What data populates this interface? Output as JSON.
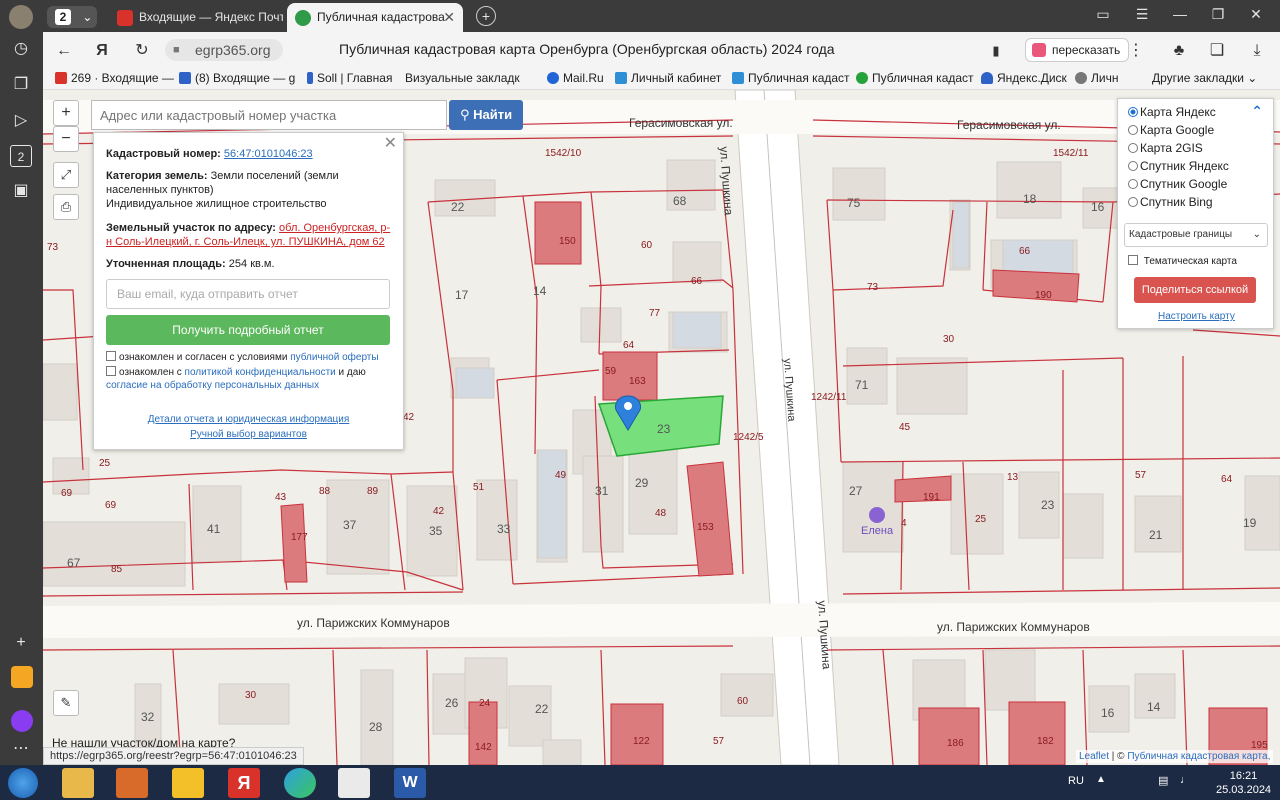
{
  "browser": {
    "tab_count": "2",
    "tabs": [
      {
        "label": "Входящие — Яндекс Почт"
      },
      {
        "label": "Публичная кадастрова"
      }
    ],
    "url": "egrp365.org",
    "page_title": "Публичная кадастровая карта Оренбурга (Оренбургская область) 2024 года",
    "translate_label": "пересказать",
    "status_url": "https://egrp365.org/reestr?egrp=56:47:0101046:23"
  },
  "bookmarks": [
    {
      "label": "269 · Входящие —",
      "color": "#d8322b"
    },
    {
      "label": "(8) Входящие — g",
      "color": "#2f62c7"
    },
    {
      "label": "Soll | Главная",
      "color": "#2f62c7"
    },
    {
      "label": "Визуальные закладк",
      "color": ""
    },
    {
      "label": "Mail.Ru",
      "color": "#1f65d6"
    },
    {
      "label": "Личный кабинет",
      "color": "#2f8fd6"
    },
    {
      "label": "Публичная кадаст",
      "color": "#2f8fd6"
    },
    {
      "label": "Публичная кадаст",
      "color": "#26a23a"
    },
    {
      "label": "Яндекс.Диск",
      "color": "#2f62c7"
    },
    {
      "label": "Личн",
      "color": "#777"
    },
    {
      "label": "Другие закладки",
      "color": ""
    }
  ],
  "search": {
    "placeholder": "Адрес или кадастровый номер участка",
    "button": "Найти"
  },
  "popup": {
    "cad_label": "Кадастровый номер:",
    "cad_value": "56:47:0101046:23",
    "category_label": "Категория земель:",
    "category_value": "Земли поселений (земли населенных пунктов)",
    "usage": "Индивидуальное жилищное строительство",
    "address_label": "Земельный участок по адресу:",
    "address_value": "обл. Оренбургская, р-н Соль-Илецкий, г. Соль-Илецк, ул. ПУШКИНА, дом 62",
    "area_label": "Уточненная площадь:",
    "area_value": "254 кв.м.",
    "email_placeholder": "Ваш email, куда отправить отчет",
    "report_button": "Получить подробный отчет",
    "consent1_a": "ознакомлен и согласен с условиями",
    "consent1_link": "публичной оферты",
    "consent2_a": "ознакомлен с",
    "consent2_link": "политикой конфиденциальности",
    "consent2_b": "и даю",
    "consent2_link2": "согласие на обработку персональных данных",
    "details_link": "Детали отчета и юридическая информация",
    "manual_link": "Ручной выбор вариантов"
  },
  "layers": {
    "options": [
      "Карта Яндекс",
      "Карта Google",
      "Карта 2GIS",
      "Спутник Яндекс",
      "Спутник Google",
      "Спутник Bing"
    ],
    "selected": "Карта Яндекс",
    "select_value": "Кадастровые границы",
    "thematic": "Тематическая карта",
    "share": "Поделиться ссылкой",
    "configure": "Настроить карту"
  },
  "map": {
    "streets": {
      "gerasimovskaya_left": "Герасимовская ул.",
      "gerasimovskaya_right": "Герасимовская ул.",
      "pushkina_top": "ул. Пушкина",
      "pushkina_mid": "ул. Пушкина",
      "pushkina_bottom": "ул. Пушкина",
      "parizh_left": "ул. Парижских Коммунаров",
      "parizh_right": "ул. Парижских Коммунаров"
    },
    "poi": "Елена",
    "not_found": "Не нашли участок/дом на карте?",
    "attribution_leaflet": "Leaflet",
    "attribution_text": "Публичная кадастровая карта,",
    "house_numbers": [
      "22",
      "68",
      "75",
      "18",
      "16",
      "150",
      "60",
      "66",
      "190",
      "73",
      "17",
      "14",
      "77",
      "66",
      "64",
      "30",
      "59",
      "163",
      "71",
      "45",
      "23",
      "1242/5",
      "27",
      "13",
      "23",
      "57",
      "64",
      "19",
      "25",
      "69",
      "41",
      "43",
      "88",
      "89",
      "42",
      "51",
      "49",
      "31",
      "29",
      "48",
      "191",
      "25",
      "21",
      "67",
      "85",
      "177",
      "37",
      "35",
      "33",
      "153",
      "4",
      "30",
      "32",
      "28",
      "26",
      "24",
      "22",
      "60",
      "57",
      "122",
      "186",
      "182",
      "195",
      "14",
      "16",
      "142",
      "1542/10",
      "1542/11",
      "1242/11",
      "73",
      "42",
      "69"
    ]
  },
  "taskbar": {
    "lang": "RU",
    "time": "16:21",
    "date": "25.03.2024"
  }
}
